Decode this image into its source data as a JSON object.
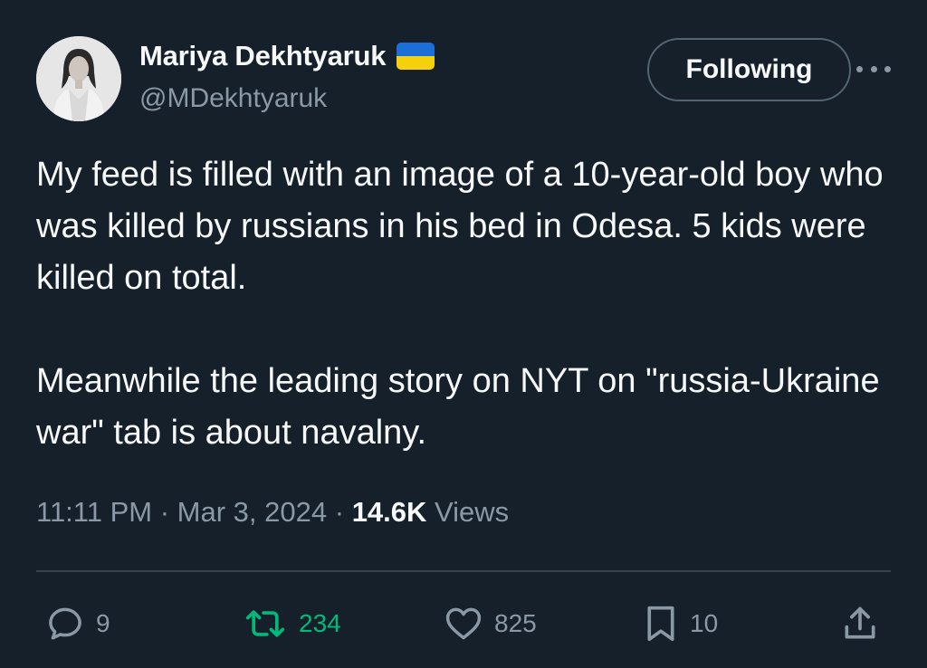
{
  "author": {
    "name": "Mariya Dekhtyaruk",
    "handle": "@MDekhtyaruk",
    "flag_icon": "ukraine-flag-icon"
  },
  "follow_button": {
    "label": "Following"
  },
  "tweet": {
    "text": "My feed is filled with an image of a 10-year-old boy who was killed by russians in his bed in Odesa. 5 kids were killed on total.\n\nMeanwhile the leading story on NYT on \"russia-Ukraine war\" tab is about navalny."
  },
  "meta": {
    "time": "11:11 PM",
    "separator": "·",
    "date": "Mar 3, 2024",
    "views_count": "14.6K",
    "views_label": "Views"
  },
  "actions": {
    "reply_count": "9",
    "retweet_count": "234",
    "like_count": "825",
    "bookmark_count": "10"
  },
  "colors": {
    "background": "#15202b",
    "text_primary": "#f7f9f9",
    "text_secondary": "#8b98a5",
    "retweet_green": "#00ba7c",
    "divider": "#38444d"
  }
}
